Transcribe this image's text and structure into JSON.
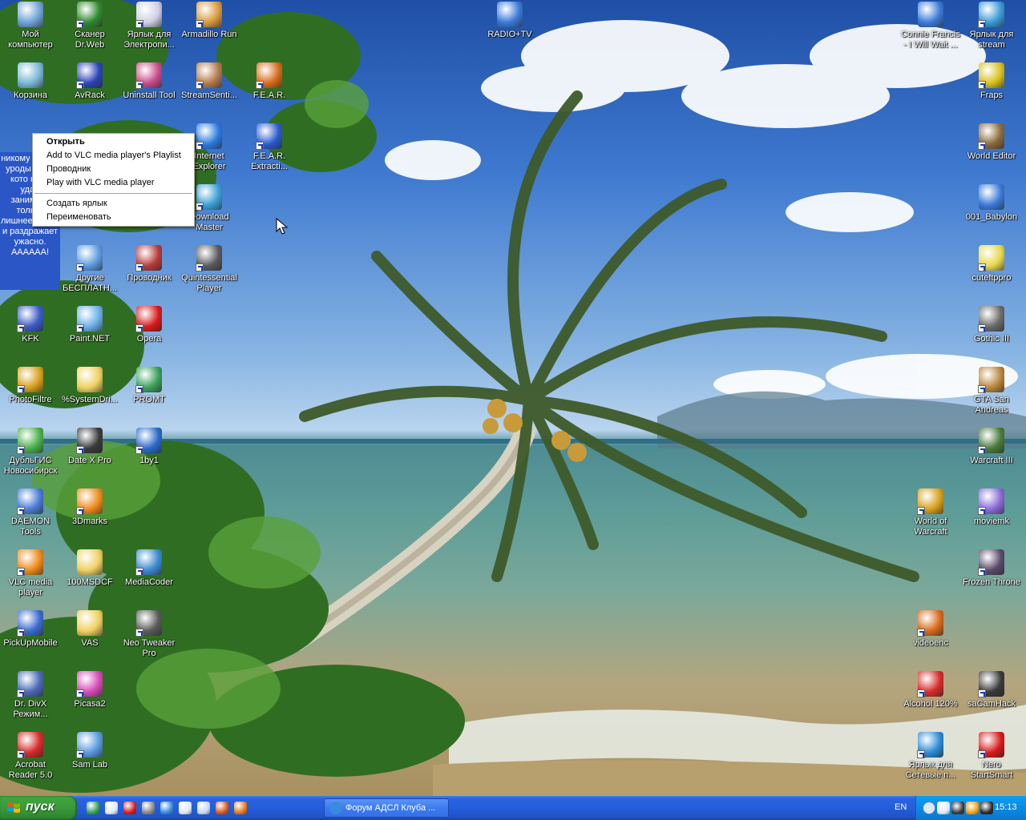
{
  "desktop": {
    "icons_left": [
      {
        "id": "my-computer",
        "label": "Мой компьютер",
        "icon": "computer-icon",
        "color": "#6fa3d8"
      },
      {
        "id": "drweb",
        "label": "Сканер Dr.Web",
        "icon": "spider-icon",
        "color": "#2f8a2f"
      },
      {
        "id": "electronic-shortcut",
        "label": "Ярлык для Электропи...",
        "icon": "people-icon",
        "color": "#cfcfe5"
      },
      {
        "id": "armadillo-run",
        "label": "Armadillo Run",
        "icon": "ball-icon",
        "color": "#d89a3a"
      },
      {
        "id": "recycle-bin",
        "label": "Корзина",
        "icon": "recycle-bin-icon",
        "color": "#79b6d8"
      },
      {
        "id": "avrack",
        "label": "AvRack",
        "icon": "rack-icon",
        "color": "#2a44b8"
      },
      {
        "id": "uninstall-tool",
        "label": "Uninstall Tool",
        "icon": "box-icon",
        "color": "#c84a8a"
      },
      {
        "id": "streamsentinel",
        "label": "StreamSenti...",
        "icon": "face-icon",
        "color": "#b47a4a"
      },
      {
        "id": "fear",
        "label": "F.E.A.R.",
        "icon": "eye-icon",
        "color": "#d86a1a"
      },
      {
        "id": "internet-explorer",
        "label": "Internet Explorer",
        "icon": "ie-icon",
        "color": "#2a7ae0"
      },
      {
        "id": "fear-extraction",
        "label": "F.E.A.R. Extracti...",
        "icon": "eye-icon",
        "color": "#2a5ad0"
      },
      {
        "id": "download-master",
        "label": "Download Master",
        "icon": "download-icon",
        "color": "#3aa0d8"
      },
      {
        "id": "other-free",
        "label": "Другие БЕСПЛАТН...",
        "icon": "document-icon",
        "color": "#5a9ae0"
      },
      {
        "id": "explorer",
        "label": "Проводник",
        "icon": "folder-tree-icon",
        "color": "#b83a3a"
      },
      {
        "id": "quintessential",
        "label": "Quintessential Player",
        "icon": "disc-icon",
        "color": "#5a5a5a"
      },
      {
        "id": "kfk",
        "label": "KFK",
        "icon": "books-icon",
        "color": "#3a5ac8"
      },
      {
        "id": "paint-net",
        "label": "Paint.NET",
        "icon": "paint-icon",
        "color": "#6ab0e8"
      },
      {
        "id": "opera",
        "label": "Opera",
        "icon": "opera-icon",
        "color": "#d81a1a"
      },
      {
        "id": "photofiltre",
        "label": "PhotoFiltre",
        "icon": "palette-icon",
        "color": "#d8a01a"
      },
      {
        "id": "systemdrive",
        "label": "%SystemDri...",
        "icon": "folder-icon",
        "color": "#f0d060"
      },
      {
        "id": "promt",
        "label": "PROMT",
        "icon": "promt-icon",
        "color": "#3aa05a"
      },
      {
        "id": "dublgis",
        "label": "ДубльГИС Новосибирск",
        "icon": "map-icon",
        "color": "#4ab04a"
      },
      {
        "id": "date-x-pro",
        "label": "Date X Pro",
        "icon": "skull-icon",
        "color": "#3a3a3a"
      },
      {
        "id": "1by1",
        "label": "1by1",
        "icon": "1by1-icon",
        "color": "#2a6ac8"
      },
      {
        "id": "daemon-tools",
        "label": "DAEMON Tools",
        "icon": "lightning-icon",
        "color": "#4a7ad8"
      },
      {
        "id": "3dmarks",
        "label": "3Dmarks",
        "icon": "list-icon",
        "color": "#f08a1a"
      },
      {
        "id": "vlc",
        "label": "VLC media player",
        "icon": "vlc-cone-icon",
        "color": "#f08a1a"
      },
      {
        "id": "100msdcf",
        "label": "100MSDCF",
        "icon": "folder-icon",
        "color": "#f0d060"
      },
      {
        "id": "mediacoder",
        "label": "MediaCoder",
        "icon": "film-icon",
        "color": "#3a8ad0"
      },
      {
        "id": "pickupmobile",
        "label": "PickUpMobile",
        "icon": "phone-icon",
        "color": "#3a6ad0"
      },
      {
        "id": "vas",
        "label": "VAS",
        "icon": "folder-icon",
        "color": "#f0d060"
      },
      {
        "id": "neo-tweaker",
        "label": "Neo Tweaker Pro",
        "icon": "dragon-icon",
        "color": "#5a5a5a"
      },
      {
        "id": "dr-divx",
        "label": "Dr. DivX Режим...",
        "icon": "doctor-icon",
        "color": "#4a6ab8"
      },
      {
        "id": "picasa2",
        "label": "Picasa2",
        "icon": "picasa-icon",
        "color": "#d84ab8"
      },
      {
        "id": "acrobat",
        "label": "Acrobat Reader 5.0",
        "icon": "acrobat-icon",
        "color": "#d82a2a"
      },
      {
        "id": "sam-lab",
        "label": "Sam Lab",
        "icon": "document-icon",
        "color": "#5a9ae0"
      }
    ],
    "icons_right": [
      {
        "id": "radio-tv",
        "label": "RADIO+TV",
        "icon": "media-file-icon",
        "color": "#3a7ad8"
      },
      {
        "id": "connie-francis",
        "label": "Connie Francis - I Will Wait ...",
        "icon": "media-file-icon",
        "color": "#3a7ad8"
      },
      {
        "id": "stream-shortcut",
        "label": "Ярлык для stream",
        "icon": "network-icon",
        "color": "#3a9ad8"
      },
      {
        "id": "fraps",
        "label": "Fraps",
        "icon": "fraps-icon",
        "color": "#d8c01a"
      },
      {
        "id": "world-editor",
        "label": "World Editor",
        "icon": "editor-icon",
        "color": "#8a6a3a"
      },
      {
        "id": "babylon",
        "label": "001_Babylon",
        "icon": "media-file-icon",
        "color": "#3a7ad8"
      },
      {
        "id": "cuteftppro",
        "label": "cuteftppro",
        "icon": "ftp-icon",
        "color": "#e8d84a"
      },
      {
        "id": "gothic3",
        "label": "Gothic III",
        "icon": "gothic-icon",
        "color": "#6a6a6a"
      },
      {
        "id": "gta-sa",
        "label": "GTA San Andreas",
        "icon": "gta-icon",
        "color": "#b8863a"
      },
      {
        "id": "warcraft3",
        "label": "Warcraft III",
        "icon": "orc-icon",
        "color": "#4a7a3a"
      },
      {
        "id": "wow",
        "label": "World of Warcraft",
        "icon": "wow-icon",
        "color": "#d8a01a"
      },
      {
        "id": "moviemk",
        "label": "moviemk",
        "icon": "moviemaker-icon",
        "color": "#8a6ad8"
      },
      {
        "id": "frozen-throne",
        "label": "Frozen Throne",
        "icon": "frozen-throne-icon",
        "color": "#5a4a6a"
      },
      {
        "id": "videoenc",
        "label": "videoenc",
        "icon": "encoder-icon",
        "color": "#d86a1a"
      },
      {
        "id": "alcohol",
        "label": "Alcohol 120%",
        "icon": "alcohol-icon",
        "color": "#d82a2a"
      },
      {
        "id": "sacamhack",
        "label": "saCamHack",
        "icon": "camera-icon",
        "color": "#3a3a3a"
      },
      {
        "id": "network-shortcut",
        "label": "Ярлык для Сетевые п...",
        "icon": "globe-icon",
        "color": "#2a8ad8"
      },
      {
        "id": "nero",
        "label": "Nero StartSmart",
        "icon": "nero-icon",
        "color": "#d81a1a"
      }
    ]
  },
  "tooltip": {
    "text": "никому нужны уроды ярлы кото нель удал занимает только лишнее место и раздражает ужасно. АААААА!"
  },
  "context_menu": {
    "items": [
      {
        "label": "Открыть",
        "bold": true
      },
      {
        "label": "Add to VLC media player's Playlist"
      },
      {
        "label": "Проводник"
      },
      {
        "label": "Play with VLC media player"
      },
      {
        "separator": true
      },
      {
        "label": "Создать ярлык"
      },
      {
        "label": "Переименовать"
      }
    ]
  },
  "taskbar": {
    "start_label": "пуск",
    "quick_launch": [
      {
        "icon": "network-icon",
        "color": "#3aa05a"
      },
      {
        "icon": "columns-icon",
        "color": "#e0e8f8"
      },
      {
        "icon": "opera-small-icon",
        "color": "#d81a1a"
      },
      {
        "icon": "disc-small-icon",
        "color": "#8a8a8a"
      },
      {
        "icon": "ie-small-icon",
        "color": "#3a8ae0"
      },
      {
        "icon": "media-small-icon",
        "color": "#e0e8f8"
      },
      {
        "icon": "window-small-icon",
        "color": "#c8d8f0"
      },
      {
        "icon": "fire-small-icon",
        "color": "#d85a1a"
      },
      {
        "icon": "firefox-small-icon",
        "color": "#e07a1a"
      }
    ],
    "task_button_label": "Форум АДСЛ Клуба ...",
    "language": "EN",
    "clock": "15:13",
    "tray_icons": [
      {
        "icon": "display-tray-icon",
        "color": "#e0e8f8"
      },
      {
        "icon": "speaker-tray-icon",
        "color": "#3a3a3a"
      },
      {
        "icon": "sun-tray-icon",
        "color": "#f0a01a"
      },
      {
        "icon": "bug-tray-icon",
        "color": "#2a2a2a"
      }
    ]
  }
}
